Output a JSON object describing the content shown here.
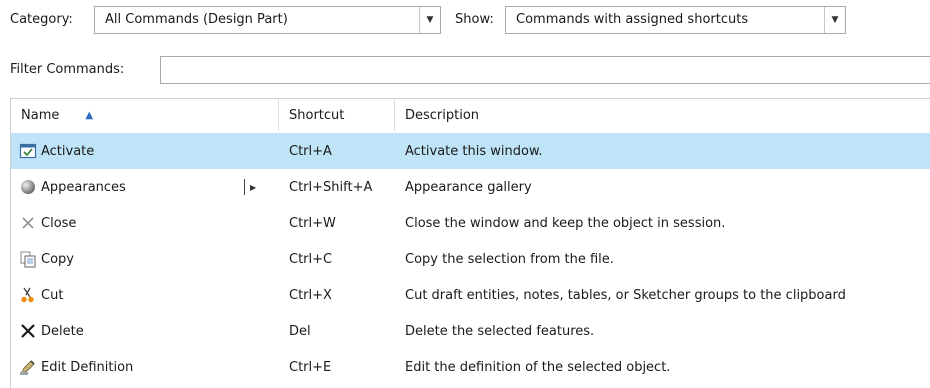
{
  "toolbar": {
    "category_label": "Category:",
    "category_value": "All Commands (Design Part)",
    "show_label": "Show:",
    "show_value": "Commands with assigned shortcuts",
    "filter_label": "Filter Commands:",
    "filter_value": ""
  },
  "table": {
    "columns": [
      "Name",
      "Shortcut",
      "Description"
    ],
    "rows": [
      {
        "name": "Activate",
        "shortcut": "Ctrl+A",
        "description": "Activate this window.",
        "icon": "activate-icon",
        "selected": true
      },
      {
        "name": "Appearances",
        "shortcut": "Ctrl+Shift+A",
        "description": "Appearance gallery",
        "icon": "appearance-sphere-icon",
        "has_submenu": true
      },
      {
        "name": "Close",
        "shortcut": "Ctrl+W",
        "description": "Close the window and keep the object in session.",
        "icon": "close-icon"
      },
      {
        "name": "Copy",
        "shortcut": "Ctrl+C",
        "description": "Copy the selection from the file.",
        "icon": "copy-icon"
      },
      {
        "name": "Cut",
        "shortcut": "Ctrl+X",
        "description": "Cut draft entities, notes, tables, or Sketcher groups to the clipboard",
        "icon": "scissors-icon"
      },
      {
        "name": "Delete",
        "shortcut": "Del",
        "description": "Delete the selected features.",
        "icon": "delete-icon"
      },
      {
        "name": "Edit Definition",
        "shortcut": "Ctrl+E",
        "description": "Edit the definition of the selected object.",
        "icon": "edit-definition-icon"
      }
    ]
  },
  "colors": {
    "selection": "#bfe3f7",
    "accent": "#2a6fbd"
  }
}
